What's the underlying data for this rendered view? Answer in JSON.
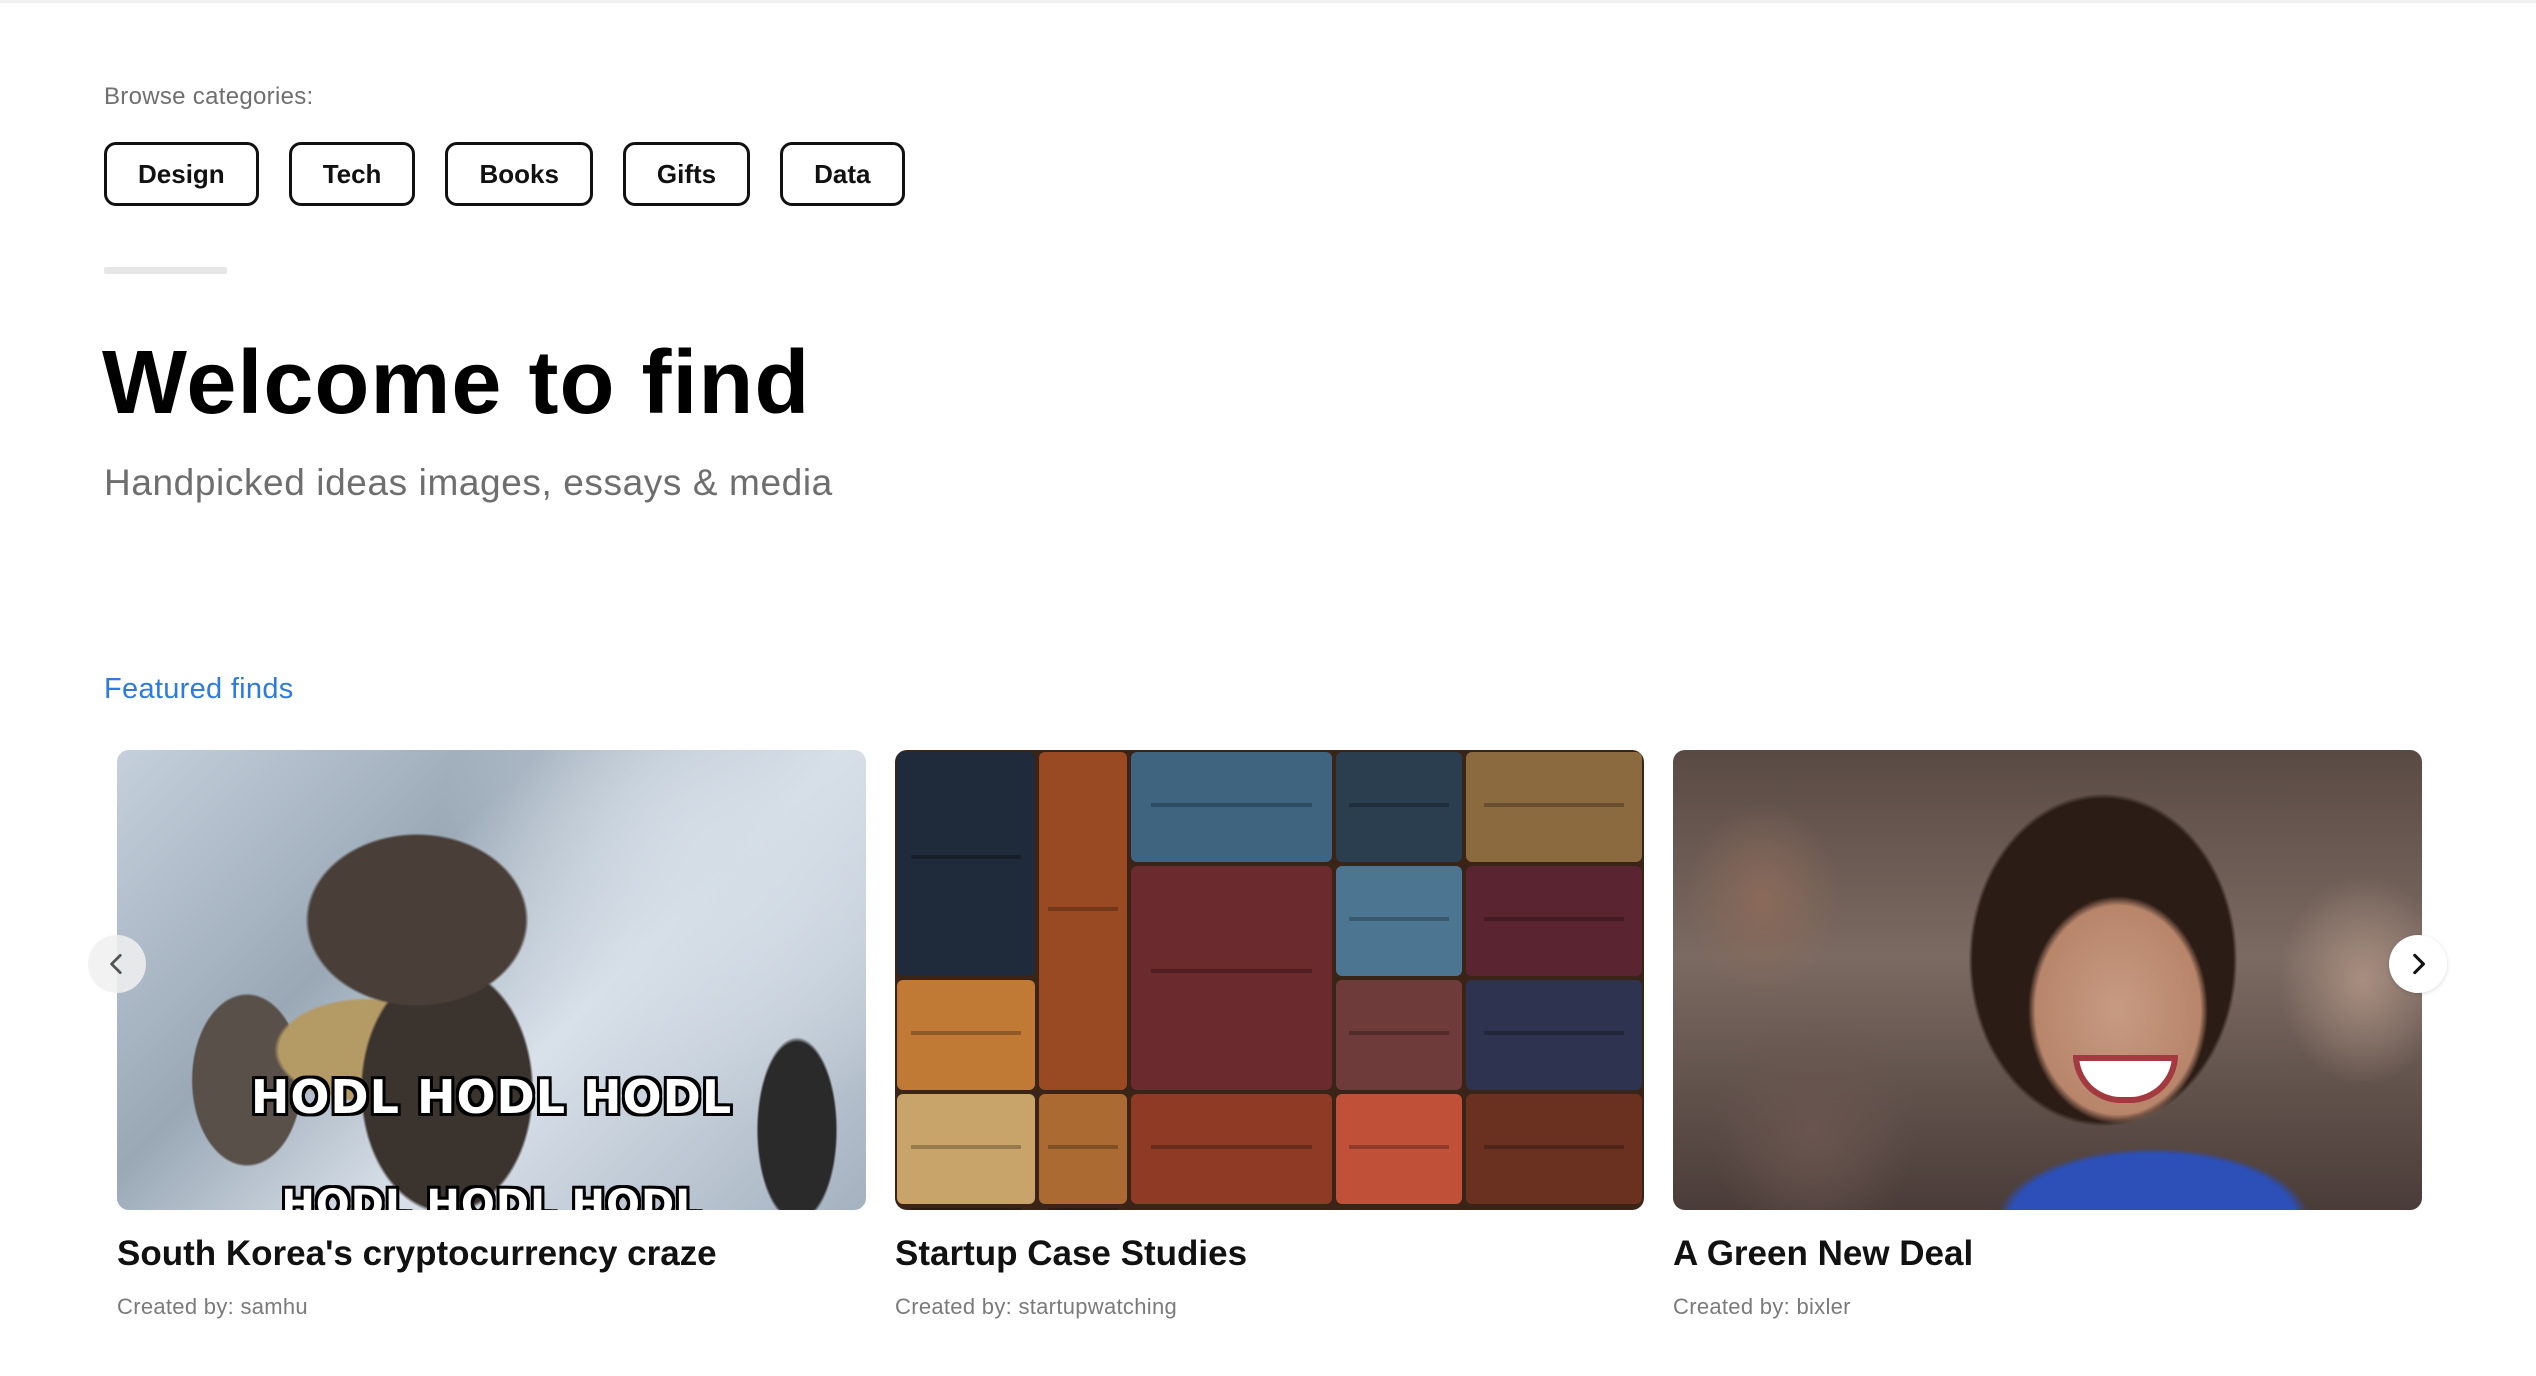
{
  "browse": {
    "label": "Browse categories:",
    "categories": [
      "Design",
      "Tech",
      "Books",
      "Gifts",
      "Data"
    ]
  },
  "hero": {
    "title": "Welcome to find",
    "subtitle": "Handpicked ideas images, essays & media"
  },
  "featured": {
    "label": "Featured finds",
    "cards": [
      {
        "title": "South Korea's cryptocurrency craze",
        "creator": "Created by: samhu",
        "image_text_1": "HODL HODL HODL",
        "image_text_2": "HODL HODL HODL"
      },
      {
        "title": "Startup Case Studies",
        "creator": "Created by: startupwatching"
      },
      {
        "title": "A Green New Deal",
        "creator": "Created by: bixler"
      }
    ],
    "prev_icon": "chevron-left-icon",
    "next_icon": "chevron-right-icon"
  },
  "colors": {
    "accent": "#2b7be0",
    "text": "#111111",
    "muted": "#6e6e6e"
  }
}
